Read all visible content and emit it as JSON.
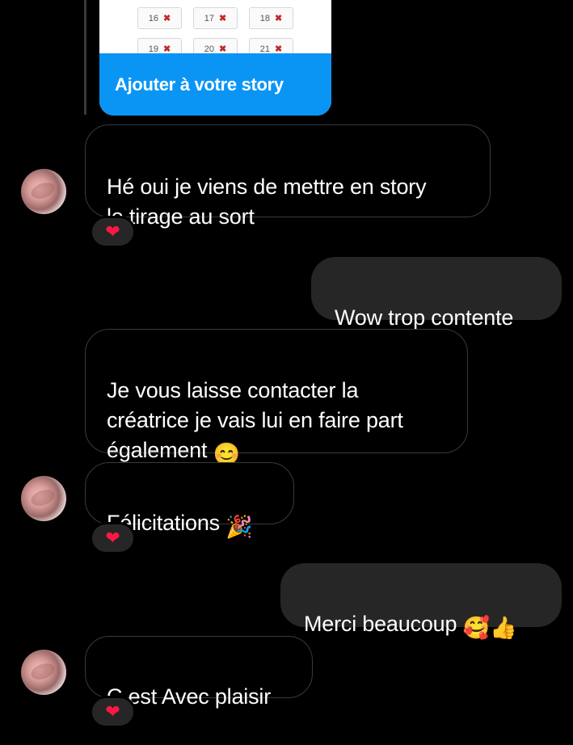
{
  "story": {
    "grid_row1": [
      "16",
      "17",
      "18"
    ],
    "grid_row2": [
      "19",
      "20",
      "21"
    ],
    "cta_label": "Ajouter à votre story"
  },
  "messages": [
    {
      "dir": "in",
      "text": "Hé oui je viens de mettre en story\nle tirage au sort",
      "reaction": "❤"
    },
    {
      "dir": "out",
      "text": "Wow trop contente"
    },
    {
      "dir": "in",
      "text": "Je vous laisse contacter la\ncréatrice je vais lui en faire part\négalement",
      "emoji": "😊"
    },
    {
      "dir": "in",
      "text": "Félicitations",
      "emoji": "🎉",
      "reaction": "❤"
    },
    {
      "dir": "out",
      "text": "Merci beaucoup",
      "emoji": "🥰👍"
    },
    {
      "dir": "in",
      "text": "C est Avec plaisir",
      "reaction": "❤"
    }
  ],
  "colors": {
    "background": "#000000",
    "outgoing_bubble": "#262626",
    "cta_blue": "#0a95f5",
    "heart": "#ff1744"
  }
}
